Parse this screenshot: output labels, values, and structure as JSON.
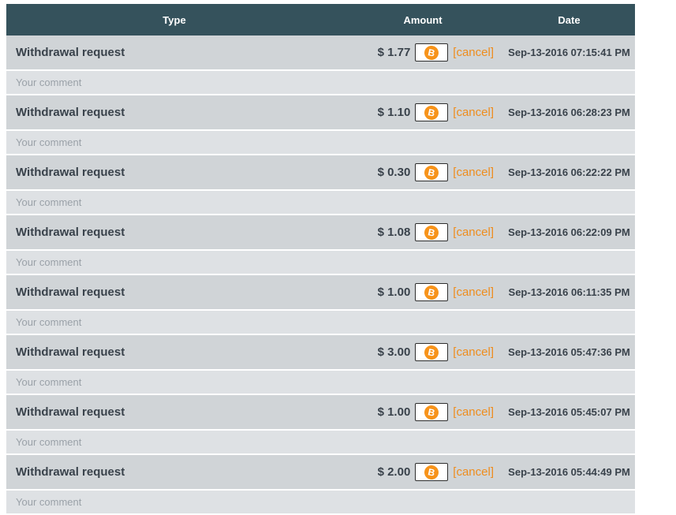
{
  "table": {
    "headers": {
      "type": "Type",
      "amount": "Amount",
      "date": "Date"
    },
    "icons": {
      "bitcoin_glyph": "B"
    },
    "colors": {
      "header_bg": "#35525c",
      "row_bg": "#d0d4d7",
      "comment_bg": "#dee1e4",
      "accent_orange": "#ee8d1e",
      "bitcoin_orange": "#f7931a"
    },
    "rows": [
      {
        "type": "Withdrawal request",
        "amount": "$ 1.77",
        "cancel": "[cancel]",
        "date": "Sep-13-2016 07:15:41 PM",
        "comment_placeholder": "Your comment"
      },
      {
        "type": "Withdrawal request",
        "amount": "$ 1.10",
        "cancel": "[cancel]",
        "date": "Sep-13-2016 06:28:23 PM",
        "comment_placeholder": "Your comment"
      },
      {
        "type": "Withdrawal request",
        "amount": "$ 0.30",
        "cancel": "[cancel]",
        "date": "Sep-13-2016 06:22:22 PM",
        "comment_placeholder": "Your comment"
      },
      {
        "type": "Withdrawal request",
        "amount": "$ 1.08",
        "cancel": "[cancel]",
        "date": "Sep-13-2016 06:22:09 PM",
        "comment_placeholder": "Your comment"
      },
      {
        "type": "Withdrawal request",
        "amount": "$ 1.00",
        "cancel": "[cancel]",
        "date": "Sep-13-2016 06:11:35 PM",
        "comment_placeholder": "Your comment"
      },
      {
        "type": "Withdrawal request",
        "amount": "$ 3.00",
        "cancel": "[cancel]",
        "date": "Sep-13-2016 05:47:36 PM",
        "comment_placeholder": "Your comment"
      },
      {
        "type": "Withdrawal request",
        "amount": "$ 1.00",
        "cancel": "[cancel]",
        "date": "Sep-13-2016 05:45:07 PM",
        "comment_placeholder": "Your comment"
      },
      {
        "type": "Withdrawal request",
        "amount": "$ 2.00",
        "cancel": "[cancel]",
        "date": "Sep-13-2016 05:44:49 PM",
        "comment_placeholder": "Your comment"
      }
    ]
  }
}
